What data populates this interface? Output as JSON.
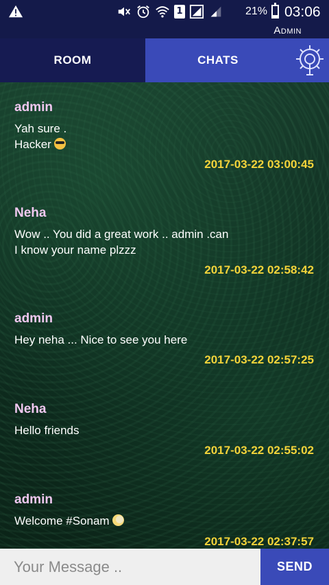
{
  "status_bar": {
    "battery_percent_label": "21%",
    "battery_level": 0.21,
    "time": "03:06",
    "sim_slot": "1",
    "icons": [
      "warning-icon",
      "mute-icon",
      "alarm-icon",
      "wifi-icon",
      "sim-icon",
      "signal-icon",
      "signal-icon-2",
      "battery-icon"
    ]
  },
  "header": {
    "username": "Admin"
  },
  "tabs": [
    {
      "label": "ROOM",
      "active": false
    },
    {
      "label": "CHATS",
      "active": true
    }
  ],
  "settings_icon": "gear-icon",
  "messages": [
    {
      "sender": "admin",
      "text": "Yah sure  .\nHacker",
      "emoji": "cool",
      "time": "2017-03-22 03:00:45"
    },
    {
      "sender": "Neha",
      "text": "Wow .. You did a great work .. admin .can\nI know your name plzzz",
      "emoji": "",
      "time": "2017-03-22 02:58:42"
    },
    {
      "sender": "admin",
      "text": "Hey neha ...  Nice to see you here",
      "emoji": "",
      "time": "2017-03-22 02:57:25"
    },
    {
      "sender": "Neha",
      "text": "Hello friends",
      "emoji": "",
      "time": "2017-03-22 02:55:02"
    },
    {
      "sender": "admin",
      "text": "Welcome #Sonam",
      "emoji": "moon",
      "time": "2017-03-22 02:37:57"
    }
  ],
  "composer": {
    "placeholder": "Your Message ..",
    "value": "",
    "send_label": "SEND"
  },
  "colors": {
    "app_bar": "#141a4a",
    "active_tab": "#3a4ab8",
    "sender": "#f0c8f0",
    "timestamp": "#f3d33a"
  }
}
